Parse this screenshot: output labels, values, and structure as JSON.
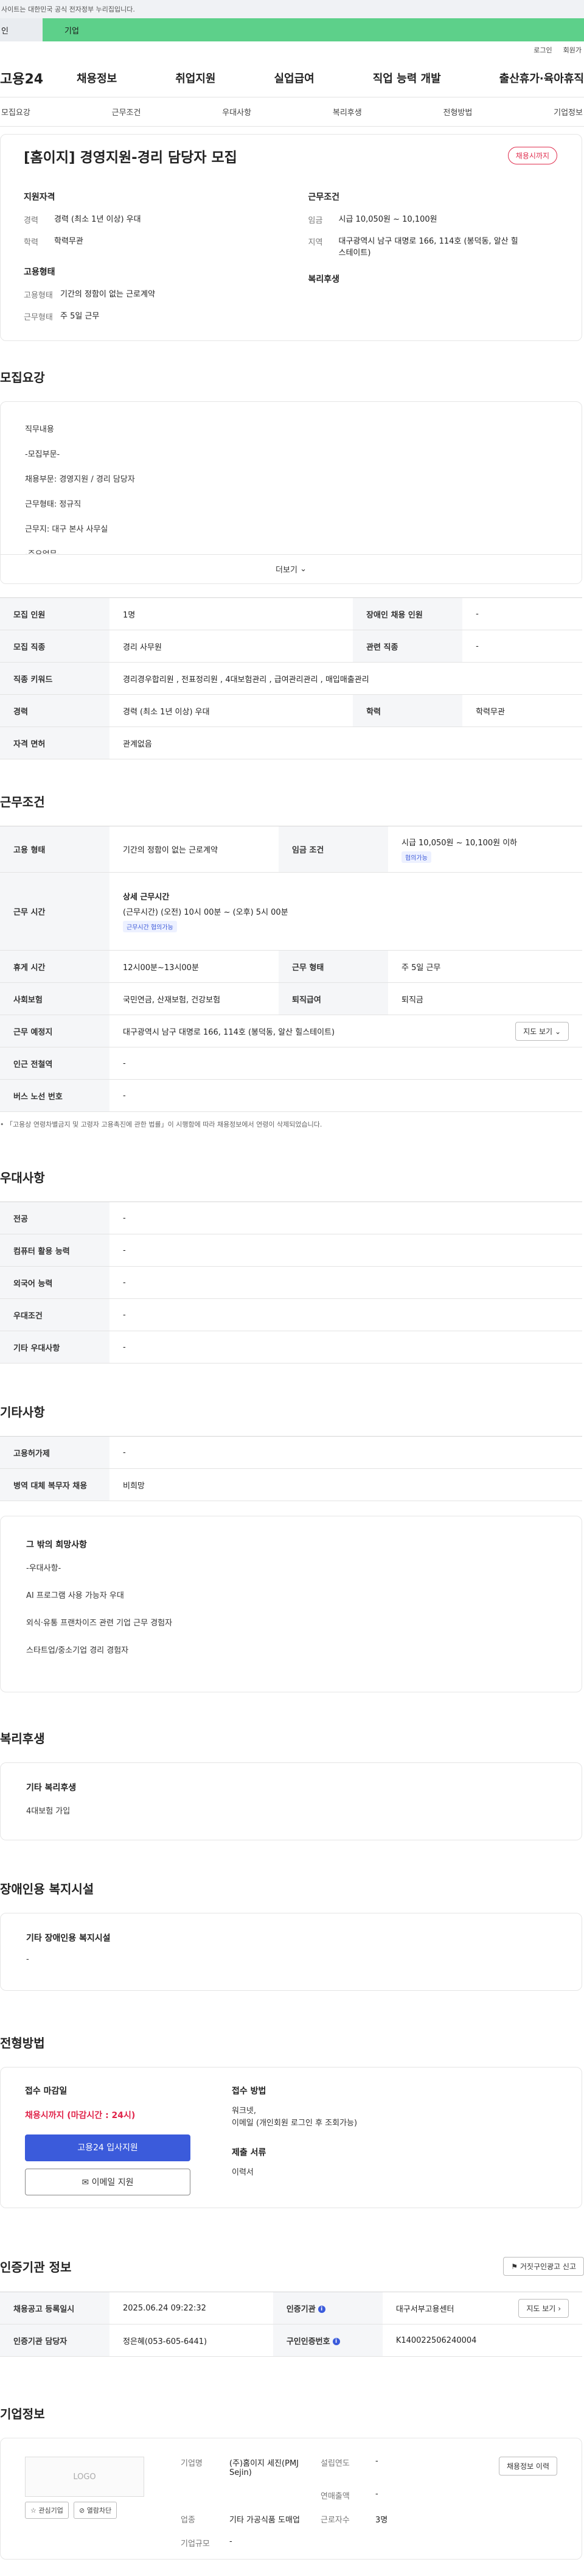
{
  "top_notice": "사이트는 대한민국 공식 전자정부 누리집입니다.",
  "tabs": [
    "인",
    "기업"
  ],
  "util": {
    "login": "로그인",
    "join": "회원가"
  },
  "site_logo": "고용24",
  "gnb": [
    "채용정보",
    "취업지원",
    "실업급여",
    "직업 능력 개발",
    "출산휴가·육아휴직"
  ],
  "subnav": [
    "모집요강",
    "근무조건",
    "우대사항",
    "복리후생",
    "전형방법",
    "기업정보"
  ],
  "job": {
    "title": "[홈이지] 경영지원-경리 담당자 모집",
    "status": "채용시까지"
  },
  "summary": {
    "qual_title": "지원자격",
    "qual": [
      {
        "k": "경력",
        "v": "경력 (최소 1년 이상) 우대"
      },
      {
        "k": "학력",
        "v": "학력무관"
      }
    ],
    "emp_title": "고용형태",
    "emp": [
      {
        "k": "고용형태",
        "v": "기간의 정함이 없는 근로계약"
      },
      {
        "k": "근무형태",
        "v": "주 5일 근무"
      }
    ],
    "cond_title": "근무조건",
    "cond": [
      {
        "k": "임금",
        "v": "시급 10,050원 ~ 10,100원"
      },
      {
        "k": "지역",
        "v": "대구광역시 남구 대명로 166, 114호 (봉덕동, 알산 힐스테이트)"
      }
    ],
    "welfare_title": "복리후생"
  },
  "recruit": {
    "section_title": "모집요강",
    "desc": [
      "직무내용",
      "-모집부문-",
      "채용부문: 경영지원 / 경리 담당자",
      "근무형태: 정규직",
      "근무지: 대구 본사 사무실",
      "-주요업무-"
    ],
    "more": "더보기",
    "rows": [
      [
        "모집 인원",
        "1명",
        "장애인 채용 인원",
        "-"
      ],
      [
        "모집 직종",
        "경리 사무원",
        "관련 직종",
        "-"
      ]
    ],
    "keyword_label": "직종 키워드",
    "keyword_value": "경리경우합리원 , 전표정리원 , 4대보험관리 , 급여관리관리 , 매입매출관리",
    "career_row": [
      "경력",
      "경력 (최소 1년 이상) 우대",
      "학력",
      "학력무관"
    ],
    "license_label": "자격 면허",
    "license_value": "관계없음"
  },
  "conditions": {
    "section_title": "근무조건",
    "emp_type_label": "고용 형태",
    "emp_type_value": "기간의 정함이 없는 근로계약",
    "wage_label": "임금 조건",
    "wage_value": "시급 10,050원 ~ 10,100원 이하",
    "wage_tag": "협의가능",
    "hours_label": "근무 시간",
    "hours_title": "상세 근무시간",
    "hours_value": "(근무시간) (오전) 10시 00분 ~ (오후) 5시 00분",
    "hours_tag": "근무시간 협의가능",
    "break_label": "휴게 시간",
    "break_value": "12시00분~13시00분",
    "work_type_label": "근무 형태",
    "work_type_value": "주 5일 근무",
    "insurance_label": "사회보험",
    "insurance_value": "국민연금, 산재보험, 건강보험",
    "retire_label": "퇴직급여",
    "retire_value": "퇴직금",
    "place_label": "근무 예정지",
    "place_value": "대구광역시 남구 대명로 166, 114호 (봉덕동, 알산 힐스테이트)",
    "map_btn": "지도 보기",
    "subway_label": "인근 전철역",
    "subway_value": "-",
    "bus_label": "버스 노선 번호",
    "bus_value": "-",
    "note": "「고용상 연령차별금지 및 고령자 고용촉진에 관한 법률」이 시행함에 따라 채용정보에서 연령이 삭제되었습니다."
  },
  "preferences": {
    "section_title": "우대사항",
    "rows": [
      [
        "전공",
        "-"
      ],
      [
        "컴퓨터 활용 능력",
        "-"
      ],
      [
        "외국어 능력",
        "-"
      ],
      [
        "우대조건",
        "-"
      ],
      [
        "기타 우대사항",
        "-"
      ]
    ]
  },
  "etc": {
    "section_title": "기타사항",
    "rows": [
      [
        "고용허가제",
        "-"
      ],
      [
        "병역 대체 복무자 채용",
        "비희망"
      ]
    ],
    "box_title": "그 밖의 희망사항",
    "box_lines": [
      "-우대사항-",
      "AI 프로그램 사용 가능자 우대",
      "외식·유통 프랜차이즈 관련 기업 근무 경험자",
      "스타트업/중소기업 경리 경험자"
    ]
  },
  "welfare": {
    "section_title": "복리후생",
    "box_title": "기타 복리후생",
    "value": "4대보험 가입"
  },
  "disability": {
    "section_title": "장애인용 복지시설",
    "box_title": "기타 장애인용 복지시설",
    "value": "-"
  },
  "apply": {
    "section_title": "전형방법",
    "deadline_title": "접수 마감일",
    "deadline_value": "채용시까지 (마감시간 : 24시)",
    "apply_btn": "고용24 입사지원",
    "email_btn": "이메일 지원",
    "method_title": "접수 방법",
    "method_value": "워크넷,\n이메일 (개인회원 로그인 후 조회가능)",
    "docs_title": "제출 서류",
    "docs_value": "이력서"
  },
  "cert": {
    "section_title": "인증기관 정보",
    "report_btn": "거짓구인광고 신고",
    "reg_label": "채용공고 등록일시",
    "reg_value": "2025.06.24 09:22:32",
    "agency_label": "인증기관",
    "agency_value": "대구서부고용센터",
    "map_btn": "지도 보기",
    "manager_label": "인증기관 담당자",
    "manager_value": "정은혜(053-605-6441)",
    "cert_no_label": "구인인증번호",
    "cert_no_value": "K140022506240004"
  },
  "company": {
    "section_title": "기업정보",
    "logo_text": "LOGO",
    "fav_btn": "관심기업",
    "block_btn": "열람차단",
    "view_btn": "채용정보 이력",
    "name_label": "기업명",
    "name_value": "(주)홈이지 세진(PMJ Sejin)",
    "year_label": "설립연도",
    "year_value": "-",
    "sales_label": "연매출액",
    "sales_value": "-",
    "industry_label": "업종",
    "industry_value": "기타 가공식품 도매업",
    "staff_label": "근로자수",
    "staff_value": "3명",
    "size_label": "기업규모",
    "size_value": "-"
  }
}
